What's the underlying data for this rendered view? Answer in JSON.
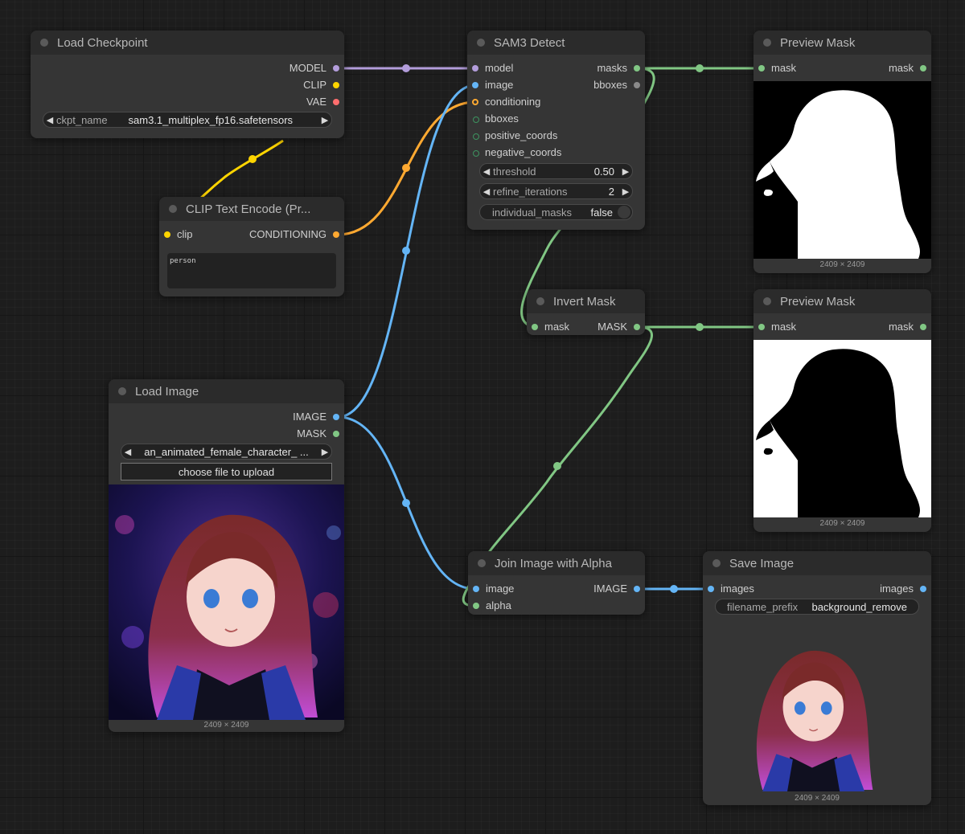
{
  "colors": {
    "MODEL": "#b39ddb",
    "CLIP": "#ffd500",
    "VAE": "#ff6e6e",
    "CONDITIONING": "#ffa931",
    "IMAGE": "#64b5f6",
    "MASK": "#81c784",
    "BBOX": "#8a8a8a",
    "background": "#1d1d1d",
    "node_body": "#353535",
    "node_title": "#2b2b2b"
  },
  "nodes": {
    "load_checkpoint": {
      "title": "Load Checkpoint",
      "outputs": [
        "MODEL",
        "CLIP",
        "VAE"
      ],
      "ckpt_name_label": "ckpt_name",
      "ckpt_name_value": "sam3.1_multiplex_fp16.safetensors"
    },
    "clip_text_encode": {
      "title": "CLIP Text Encode (Pr...",
      "input": "clip",
      "output": "CONDITIONING",
      "text": "person"
    },
    "load_image": {
      "title": "Load Image",
      "outputs": [
        "IMAGE",
        "MASK"
      ],
      "image_value": "an_animated_female_character_ ...",
      "upload_label": "choose file to upload",
      "dims": "2409 × 2409"
    },
    "sam3_detect": {
      "title": "SAM3 Detect",
      "inputs": [
        "model",
        "image",
        "conditioning",
        "bboxes",
        "positive_coords",
        "negative_coords"
      ],
      "outputs": [
        "masks",
        "bboxes"
      ],
      "threshold_label": "threshold",
      "threshold_value": "0.50",
      "refine_label": "refine_iterations",
      "refine_value": "2",
      "individual_label": "individual_masks",
      "individual_value": "false"
    },
    "preview_mask_1": {
      "title": "Preview Mask",
      "input": "mask",
      "output": "mask",
      "dims": "2409 × 2409"
    },
    "invert_mask": {
      "title": "Invert Mask",
      "input": "mask",
      "output": "MASK"
    },
    "preview_mask_2": {
      "title": "Preview Mask",
      "input": "mask",
      "output": "mask",
      "dims": "2409 × 2409"
    },
    "join_image_alpha": {
      "title": "Join Image with Alpha",
      "inputs": [
        "image",
        "alpha"
      ],
      "output": "IMAGE"
    },
    "save_image": {
      "title": "Save Image",
      "input": "images",
      "output": "images",
      "prefix_label": "filename_prefix",
      "prefix_value": "background_remove",
      "dims": "2409 × 2409"
    }
  }
}
